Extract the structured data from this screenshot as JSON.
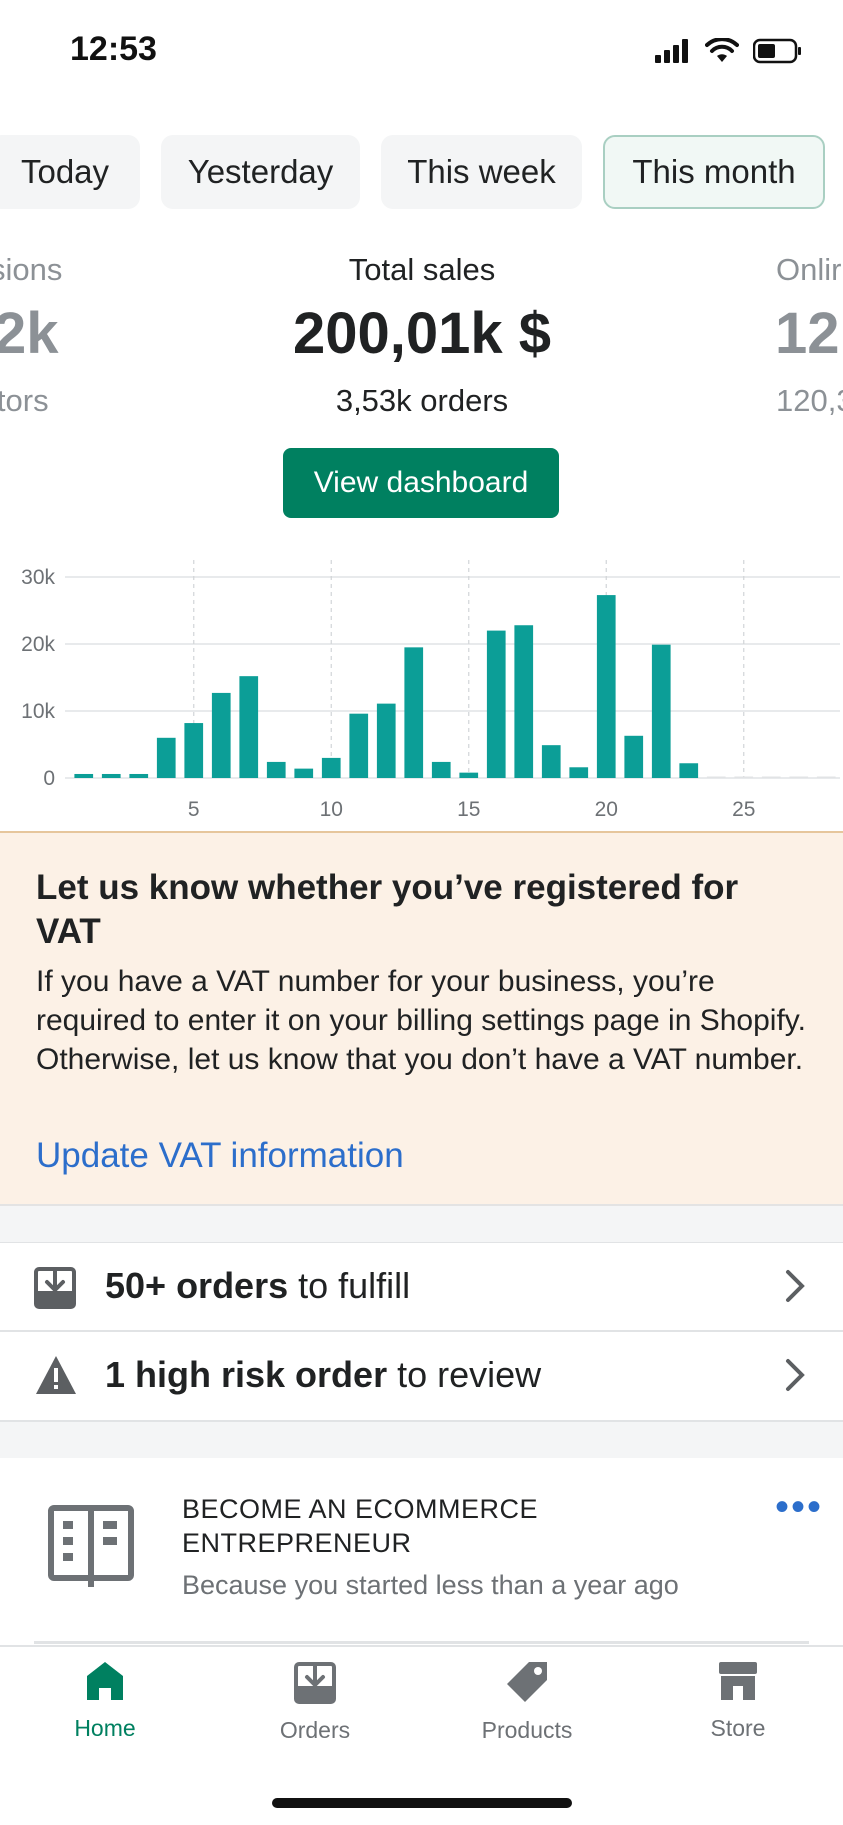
{
  "status_bar": {
    "time": "12:53"
  },
  "tabs": [
    {
      "label": "Today",
      "active": false
    },
    {
      "label": "Yesterday",
      "active": false
    },
    {
      "label": "This week",
      "active": false
    },
    {
      "label": "This month",
      "active": true
    }
  ],
  "metrics": {
    "left": {
      "label": "sions",
      "value": "2k",
      "sub": "itors"
    },
    "center": {
      "label": "Total sales",
      "value": "200,01k $",
      "sub": "3,53k orders"
    },
    "right": {
      "label": "Onlir",
      "value": "12",
      "sub": "120,3"
    }
  },
  "dashboard_button": "View dashboard",
  "chart_data": {
    "type": "bar",
    "color": "#0c9e97",
    "x": [
      1,
      2,
      3,
      4,
      5,
      6,
      7,
      8,
      9,
      10,
      11,
      12,
      13,
      14,
      15,
      16,
      17,
      18,
      19,
      20,
      21,
      22,
      23,
      24,
      25,
      26,
      27,
      28
    ],
    "values": [
      600,
      600,
      600,
      6000,
      8200,
      12700,
      15200,
      2400,
      1400,
      3000,
      9600,
      11100,
      19500,
      2400,
      800,
      22000,
      22800,
      4900,
      1600,
      27300,
      6300,
      19900,
      2200,
      0,
      0,
      0,
      0,
      0
    ],
    "ylim": [
      0,
      30000
    ],
    "yticks": [
      "0",
      "10k",
      "20k",
      "30k"
    ],
    "xticks": [
      "5",
      "10",
      "15",
      "20",
      "25"
    ],
    "grid": true
  },
  "vat_banner": {
    "title": "Let us know whether you’ve registered for VAT",
    "body": "If you have a VAT number for your business, you’re required to enter it on your billing settings page in Shopify. Otherwise, let us know that you don’t have a VAT number.",
    "link": "Update VAT information"
  },
  "tasks": [
    {
      "bold": "50+ orders",
      "rest": " to fulfill",
      "icon": "download-box-icon"
    },
    {
      "bold": "1 high risk order",
      "rest": " to review",
      "icon": "warning-triangle-icon"
    }
  ],
  "promo_card": {
    "title": "BECOME AN ECOMMERCE ENTREPRENEUR",
    "subtitle": "Because you started less than a year ago",
    "icon": "book-icon",
    "more": "•••"
  },
  "bottom_nav": [
    {
      "label": "Home",
      "icon": "home-icon",
      "active": true
    },
    {
      "label": "Orders",
      "icon": "orders-icon",
      "active": false
    },
    {
      "label": "Products",
      "icon": "tag-icon",
      "active": false
    },
    {
      "label": "Store",
      "icon": "store-icon",
      "active": false
    }
  ]
}
